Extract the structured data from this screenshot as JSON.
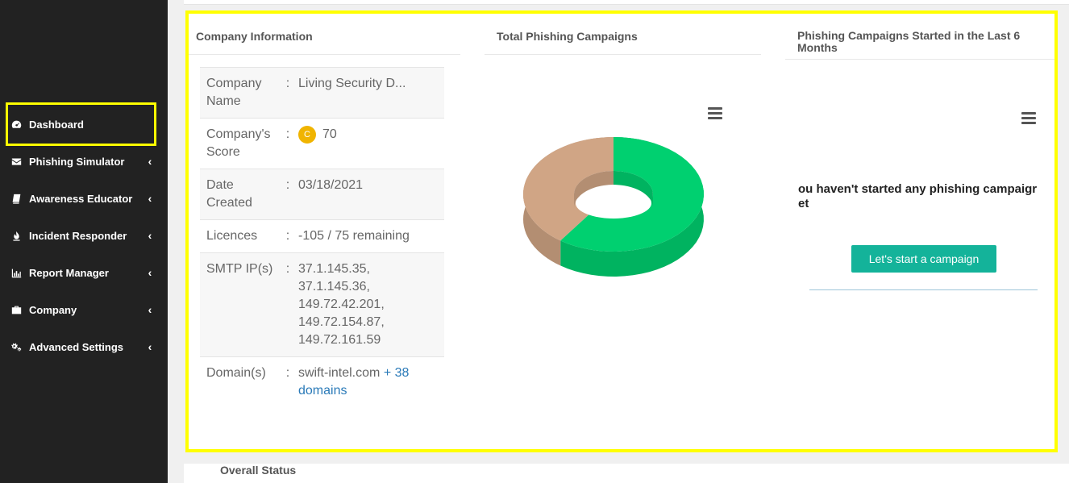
{
  "sidebar": {
    "items": [
      {
        "label": "Dashboard",
        "icon": "dashboard-icon",
        "active": true
      },
      {
        "label": "Phishing Simulator",
        "icon": "envelope-icon"
      },
      {
        "label": "Awareness Educator",
        "icon": "book-icon"
      },
      {
        "label": "Incident Responder",
        "icon": "fire-icon"
      },
      {
        "label": "Report Manager",
        "icon": "bar-chart-icon"
      },
      {
        "label": "Company",
        "icon": "briefcase-icon"
      },
      {
        "label": "Advanced Settings",
        "icon": "gears-icon"
      }
    ],
    "chevron": "‹"
  },
  "company_info": {
    "title": "Company Information",
    "separator": ":",
    "name_label": "Company Name",
    "name_value": "Living Security D...",
    "score_label": "Company's Score",
    "score_grade": "C",
    "score_value": "70",
    "date_label": "Date Created",
    "date_value": "03/18/2021",
    "licences_label": "Licences",
    "licences_value": "-105 / 75 remaining",
    "smtp_label": "SMTP IP(s)",
    "smtp_values": [
      "37.1.145.35,",
      "37.1.145.36,",
      "149.72.42.201,",
      "149.72.154.87,",
      "149.72.161.59"
    ],
    "domains_label": "Domain(s)",
    "domains_value": "swift-intel.com",
    "domains_more": "+ 38 domains"
  },
  "total_campaigns": {
    "title": "Total Phishing Campaigns"
  },
  "chart_data": {
    "type": "pie",
    "values": [
      0.6,
      0.4
    ],
    "colors": [
      "#00d070",
      "#d0a585"
    ]
  },
  "recent_campaigns": {
    "title": "Phishing Campaigns Started in the Last 6 Months",
    "message_line1": "ou haven't started any phishing campaigr",
    "message_line2": "et",
    "button_label": "Let's start a campaign"
  },
  "overall_status": {
    "title": "Overall Status"
  },
  "colors": {
    "accent": "#14b39a",
    "highlight": "#ffff00",
    "sidebar_bg": "#222222",
    "score_badge": "#f0b400",
    "link": "#2a7ab8"
  }
}
